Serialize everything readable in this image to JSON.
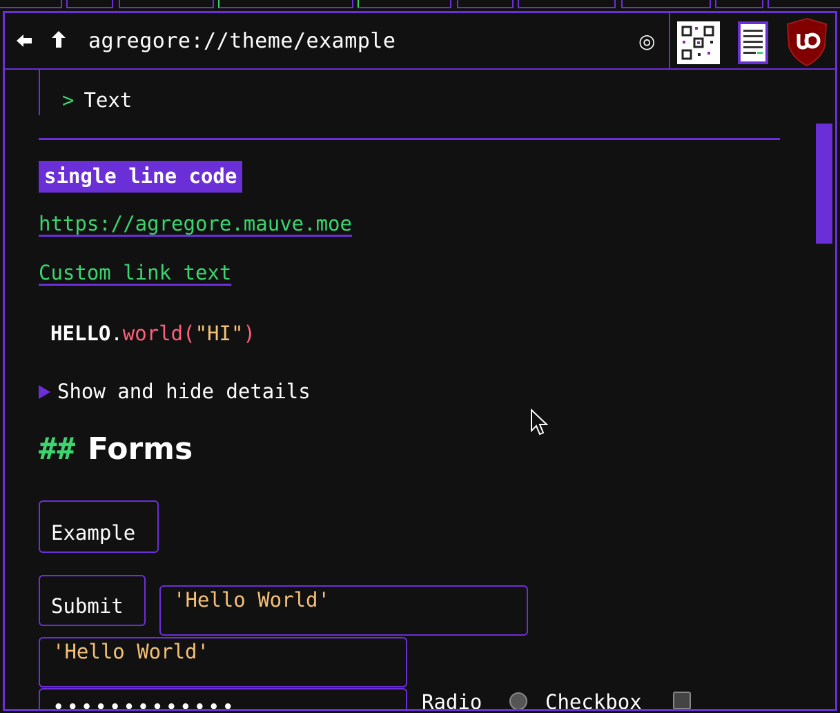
{
  "browser": {
    "back_icon": "arrow-left-icon",
    "up_icon": "arrow-up-icon",
    "url": "agregore://theme/example",
    "target_glyph": "◎",
    "extensions": [
      "qr-code-icon",
      "notes-icon",
      "ublock-origin-icon"
    ]
  },
  "content": {
    "blockquote": {
      "marker": ">",
      "text": "Text"
    },
    "inline_code": "single line code",
    "link_url": "https://agregore.mauve.moe",
    "link_custom": "Custom link text",
    "code": {
      "object": "HELLO",
      "dot": ".",
      "method": "world",
      "open": "(",
      "string": "\"HI\"",
      "close": ")"
    },
    "details_summary": "Show and hide details",
    "forms_heading": {
      "hash": "##",
      "text": "Forms"
    },
    "forms": {
      "example_button": "Example",
      "submit_button": "Submit",
      "text_value_1": "'Hello World'",
      "text_value_2": "'Hello World'",
      "password_mask": "•••••••••••••",
      "radio_label": "Radio",
      "checkbox_label": "Checkbox"
    }
  },
  "colors": {
    "accent": "#6b2fd8",
    "link": "#3bd46f",
    "background": "#111111",
    "string": "#f6c177",
    "function": "#ff5f7a"
  }
}
